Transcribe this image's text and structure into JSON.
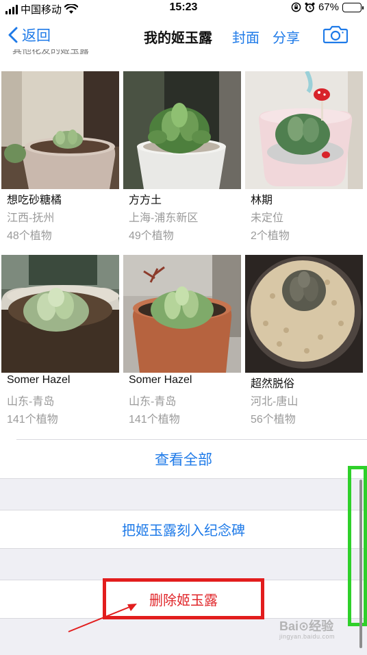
{
  "status_bar": {
    "carrier": "中国移动",
    "time": "15:23",
    "battery_percent": "67%",
    "battery_level": 0.67,
    "icons": [
      "signal-icon",
      "wifi-icon",
      "rotation-lock-icon",
      "alarm-icon",
      "battery-icon"
    ]
  },
  "nav": {
    "back_label": "返回",
    "title": "我的姬玉露",
    "cover_label": "封面",
    "share_label": "分享",
    "camera_icon": "camera-icon"
  },
  "section_label": "其他花友的姬玉露",
  "cards": [
    {
      "name": "想吃砂糖橘",
      "location": "江西-抚州",
      "plants": "48个植物"
    },
    {
      "name": "方方土",
      "location": "上海-浦东新区",
      "plants": "49个植物"
    },
    {
      "name": "林期",
      "location": "未定位",
      "plants": "2个植物"
    },
    {
      "name": "Somer Hazel",
      "location": "山东-青岛",
      "plants": "141个植物"
    },
    {
      "name": "Somer Hazel",
      "location": "山东-青岛",
      "plants": "141个植物"
    },
    {
      "name": "超然脱俗",
      "location": "河北-唐山",
      "plants": "56个植物"
    }
  ],
  "view_all_label": "查看全部",
  "memorial_label": "把姬玉露刻入纪念碑",
  "delete_label": "删除姬玉露",
  "watermark": {
    "main": "Bai⊙经验",
    "sub": "jingyan.baidu.com"
  },
  "colors": {
    "accent_blue": "#1e7ae8",
    "delete_red": "#e0262a",
    "annotation_red": "#e21d1d",
    "annotation_green": "#2fd02a",
    "group_background": "#efeff4"
  }
}
